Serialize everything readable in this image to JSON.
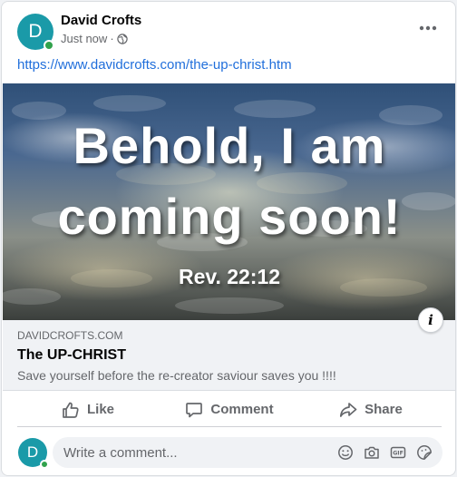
{
  "post": {
    "author": "David Crofts",
    "avatar_letter": "D",
    "timestamp": "Just now",
    "separator": "·",
    "audience_icon": "globe-icon",
    "more_icon": "more-options-icon",
    "link_url": "https://www.davidcrofts.com/the-up-christ.htm"
  },
  "image": {
    "line1": "Behold, I am",
    "line2": "coming soon!",
    "line3": "Rev. 22:12",
    "info_label": "i"
  },
  "preview": {
    "domain": "DAVIDCROFTS.COM",
    "title": "The UP-CHRIST",
    "description": "Save yourself before the re-creator saviour saves you !!!!"
  },
  "actions": [
    {
      "label": "Like",
      "icon": "thumbs-up-icon"
    },
    {
      "label": "Comment",
      "icon": "comment-bubble-icon"
    },
    {
      "label": "Share",
      "icon": "share-arrow-icon"
    }
  ],
  "comment": {
    "avatar_letter": "D",
    "placeholder": "Write a comment...",
    "icons": [
      "emoji-icon",
      "camera-icon",
      "gif-icon",
      "sticker-icon"
    ]
  },
  "colors": {
    "link": "#216fdb",
    "avatar": "#1a9aa8",
    "online": "#31a24c",
    "secondary_text": "#65676b"
  }
}
